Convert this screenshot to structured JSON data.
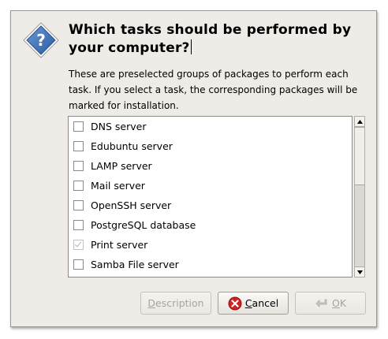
{
  "dialog": {
    "title": "Which tasks should be performed by your computer?",
    "description": "These are preselected groups of packages to perform each task. If you select a task, the corresponding packages will be marked for installation."
  },
  "task_list": [
    {
      "label": "DNS server",
      "checked": false,
      "disabled": false
    },
    {
      "label": "Edubuntu server",
      "checked": false,
      "disabled": false
    },
    {
      "label": "LAMP server",
      "checked": false,
      "disabled": false
    },
    {
      "label": "Mail server",
      "checked": false,
      "disabled": false
    },
    {
      "label": "OpenSSH server",
      "checked": false,
      "disabled": false
    },
    {
      "label": "PostgreSQL database",
      "checked": false,
      "disabled": false
    },
    {
      "label": "Print server",
      "checked": true,
      "disabled": true
    },
    {
      "label": "Samba File server",
      "checked": false,
      "disabled": false
    }
  ],
  "buttons": {
    "description": {
      "label_mnemonic": "D",
      "label_rest": "escription",
      "enabled": false
    },
    "cancel": {
      "label_mnemonic": "C",
      "label_rest": "ancel",
      "enabled": true,
      "icon": "cancel-icon"
    },
    "ok": {
      "label_mnemonic": "O",
      "label_rest": "K",
      "enabled": false,
      "icon": "back-arrow-icon"
    }
  },
  "icons": {
    "dialog_icon": "question-icon"
  },
  "colors": {
    "question_icon": "#3d6fb5",
    "cancel_icon": "#d42020",
    "window_bg": "#efebe7"
  }
}
